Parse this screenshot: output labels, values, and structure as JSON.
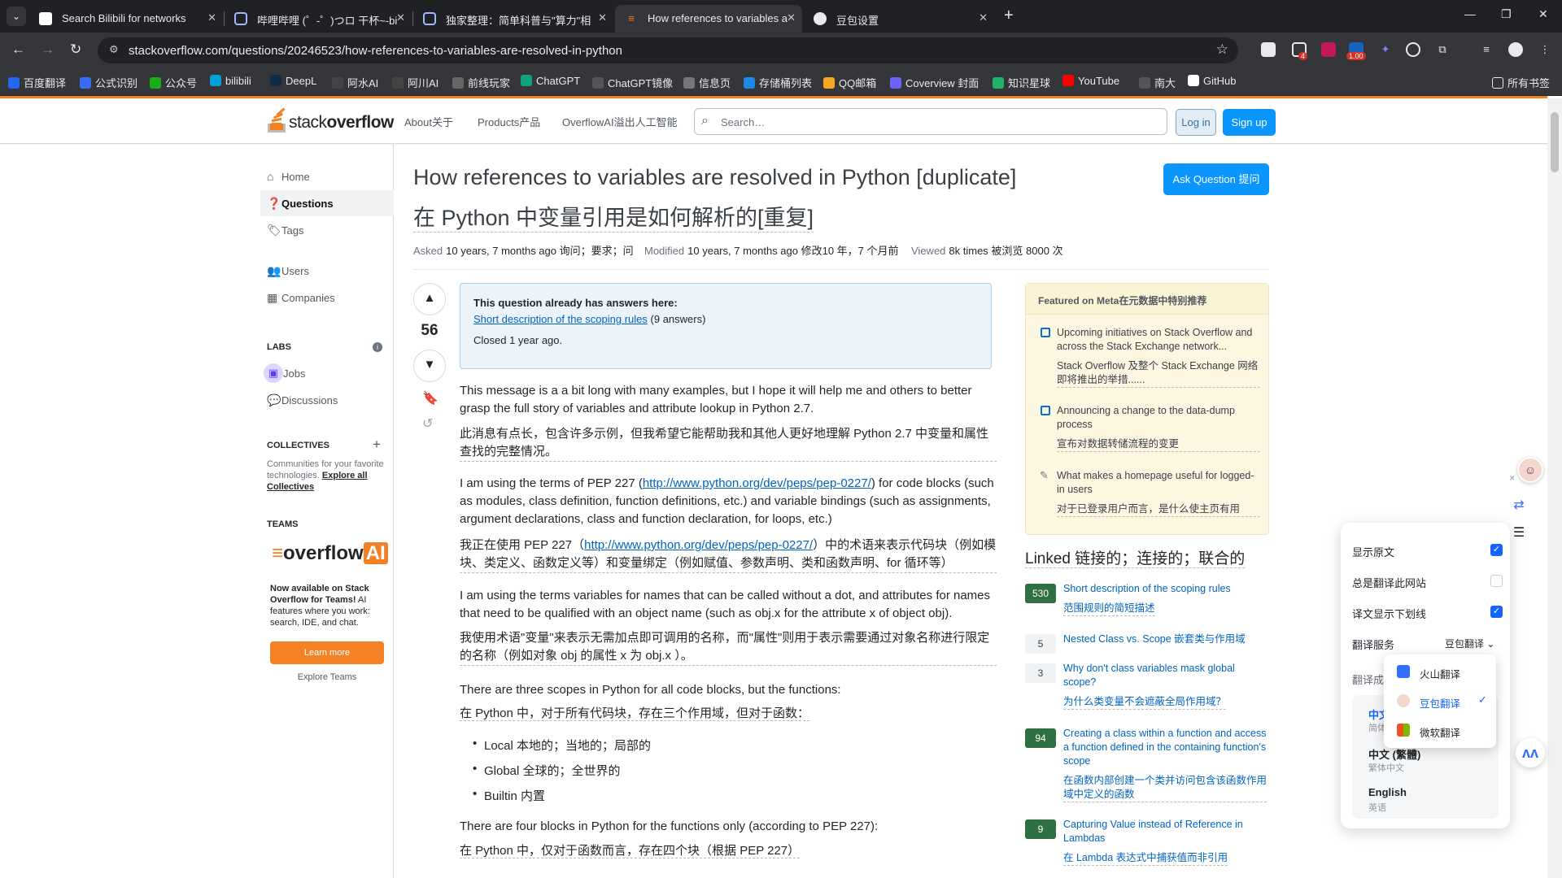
{
  "browser": {
    "tabs": [
      {
        "title": "Search Bilibili for networks"
      },
      {
        "title": "哔哩哔哩 (゜-゜)つロ 干杯~-bi"
      },
      {
        "title": "独家整理：简单科普与\"算力\"相"
      },
      {
        "title": "How references to variables a"
      },
      {
        "title": "豆包设置"
      }
    ],
    "url": "stackoverflow.com/questions/20246523/how-references-to-variables-are-resolved-in-python",
    "extensions": [
      {
        "badge": ""
      },
      {
        "badge": "4"
      },
      {
        "badge": ""
      },
      {
        "badge": "1.00"
      },
      {
        "badge": ""
      },
      {
        "badge": ""
      },
      {
        "badge": ""
      }
    ],
    "bookmarks": [
      {
        "label": "百度翻译",
        "color": "#2468f2"
      },
      {
        "label": "公式识别",
        "color": "#3b6cf6"
      },
      {
        "label": "公众号",
        "color": "#1aad19"
      },
      {
        "label": "bilibili",
        "color": "#00a1d6"
      },
      {
        "label": "DeepL",
        "color": "#0f2b46"
      },
      {
        "label": "阿水AI",
        "color": "#444"
      },
      {
        "label": "阿川AI",
        "color": "#444"
      },
      {
        "label": "前线玩家",
        "color": "#666"
      },
      {
        "label": "ChatGPT",
        "color": "#10a37f"
      },
      {
        "label": "ChatGPT镜像",
        "color": "#555"
      },
      {
        "label": "信息页",
        "color": "#777"
      },
      {
        "label": "存储桶列表",
        "color": "#1e88e5"
      },
      {
        "label": "QQ邮箱",
        "color": "#f5a623"
      },
      {
        "label": "Coverview 封面",
        "color": "#6c63ff"
      },
      {
        "label": "知识星球",
        "color": "#1fb36b"
      },
      {
        "label": "YouTube",
        "color": "#ff0000"
      },
      {
        "label": "南大",
        "color": "#555"
      },
      {
        "label": "GitHub",
        "color": "#fff"
      }
    ],
    "all_bookmarks": "所有书签"
  },
  "so": {
    "logo_light": "stack",
    "logo_bold": "overflow",
    "nav": [
      "About关于",
      "Products产品",
      "OverflowAI溢出人工智能"
    ],
    "search_placeholder": "Search…",
    "login": "Log in",
    "signup": "Sign up",
    "sidebar": {
      "items": [
        "Home",
        "Questions",
        "Tags",
        "Users",
        "Companies"
      ],
      "labs_head": "LABS",
      "labs_items": [
        "Jobs",
        "Discussions"
      ],
      "collectives_head": "COLLECTIVES",
      "collectives_text": "Communities for your favorite technologies.",
      "collectives_link": "Explore all Collectives",
      "teams_head": "TEAMS",
      "oai_word": "overflow",
      "oai_badge": "AI",
      "teams_bold": "Now available on Stack Overflow for Teams!",
      "teams_rest": "AI features where you work: search, IDE, and chat.",
      "learn_more": "Learn more",
      "explore_teams": "Explore Teams"
    },
    "question": {
      "title": "How references to variables are resolved in Python [duplicate]",
      "title_zh": "在 Python 中变量引用是如何解析的[重复]",
      "ask_button": "Ask Question 提问",
      "asked_label": "Asked",
      "asked_value": "10 years, 7 months ago 询问；要求；问",
      "modified_label": "Modified",
      "modified_value": "10 years, 7 months ago 修改10 年，7 个月前",
      "viewed_label": "Viewed",
      "viewed_value": "8k times 被浏览 8000 次",
      "votes": "56",
      "dup_head": "This question already has answers here:",
      "dup_link": "Short description of the scoping rules",
      "dup_count": "(9 answers)",
      "dup_closed": "Closed 1 year ago.",
      "p1": "This message is a a bit long with many examples, but I hope it will help me and others to better grasp the full story of variables and attribute lookup in Python 2.7.",
      "p1_zh": "此消息有点长，包含许多示例，但我希望它能帮助我和其他人更好地理解 Python 2.7 中变量和属性查找的完整情况。",
      "p2_a": "I am using the terms of PEP 227 (",
      "p2_link": "http://www.python.org/dev/peps/pep-0227/",
      "p2_b": ") for code blocks (such as modules, class definition, function definitions, etc.) and variable bindings (such as assignments, argument declarations, class and function declaration, for loops, etc.)",
      "p2_zh_a": "我正在使用 PEP 227（",
      "p2_zh_b": "）中的术语来表示代码块（例如模块、类定义、函数定义等）和变量绑定（例如赋值、参数声明、类和函数声明、for 循环等）",
      "p3": "I am using the terms variables for names that can be called without a dot, and attributes for names that need to be qualified with an object name (such as obj.x for the attribute x of object obj).",
      "p3_zh": "我使用术语\"变量\"来表示无需加点即可调用的名称，而\"属性\"则用于表示需要通过对象名称进行限定的名称（例如对象 obj 的属性 x 为 obj.x ）。",
      "p4": "There are three scopes in Python for all code blocks, but the functions:",
      "p4_zh": "在 Python 中，对于所有代码块，存在三个作用域，但对于函数：",
      "bullets": [
        "Local 本地的；当地的；局部的",
        "Global 全球的；全世界的",
        "Builtin 内置"
      ],
      "p5": "There are four blocks in Python for the functions only (according to PEP 227):",
      "p5_zh": "在 Python 中，仅对于函数而言，存在四个块（根据 PEP 227）"
    },
    "featured": {
      "head": "Featured on Meta在元数据中特别推荐",
      "items": [
        {
          "en": "Upcoming initiatives on Stack Overflow and across the Stack Exchange network...",
          "zh": "Stack Overflow 及整个 Stack Exchange 网络即将推出的举措......"
        },
        {
          "en": "Announcing a change to the data-dump process",
          "zh": "宣布对数据转储流程的变更"
        },
        {
          "en": "What makes a homepage useful for logged-in users",
          "zh": "对于已登录用户而言，是什么使主页有用"
        }
      ]
    },
    "linked": {
      "head": "Linked 链接的；连接的；联合的",
      "items": [
        {
          "count": "530",
          "en": "Short description of the scoping rules",
          "zh": "范围规则的简短描述",
          "answered": true
        },
        {
          "count": "5",
          "en": "Nested Class vs. Scope 嵌套类与作用域",
          "zh": "",
          "answered": false
        },
        {
          "count": "3",
          "en": "Why don't class variables mask global scope?",
          "zh": "为什么类变量不会遮蔽全局作用域？",
          "answered": false
        },
        {
          "count": "94",
          "en": "Creating a class within a function and access a function defined in the containing function's scope",
          "zh": "在函数内部创建一个类并访问包含该函数作用域中定义的函数",
          "answered": true
        },
        {
          "count": "9",
          "en": "Capturing Value instead of Reference in Lambdas",
          "zh": "在 Lambda 表达式中捕获值而非引用",
          "answered": true
        }
      ]
    }
  },
  "translator": {
    "show_original": "显示原文",
    "always_translate": "总是翻译此网站",
    "underline": "译文显示下划线",
    "service_label": "翻译服务",
    "service_value": "豆包翻译",
    "translate_to": "翻译成",
    "langs": [
      {
        "name": "中文",
        "sub": "简体中文"
      },
      {
        "name": "中文 (繁體)",
        "sub": "繁体中文"
      },
      {
        "name": "English",
        "sub": "英语"
      }
    ],
    "services": [
      "火山翻译",
      "豆包翻译",
      "微软翻译"
    ],
    "checked_mark": "✓"
  }
}
